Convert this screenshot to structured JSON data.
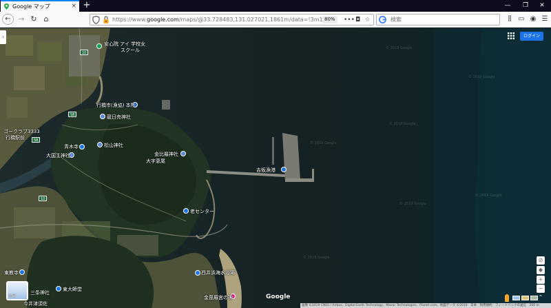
{
  "browser": {
    "tab_title": "Google マップ",
    "tab_close": "×",
    "new_tab": "+",
    "url_prefix": "https://www.",
    "url_domain": "google.com",
    "url_path": "/maps/@33.728483,131.027021,1861m/data=!3m1!1e3",
    "zoom": "80%",
    "search_placeholder": "検索",
    "colors": {
      "tabbar": "#0c0c1c",
      "accent": "#0a84ff"
    }
  },
  "map": {
    "login_label": "ログイン",
    "google_logo": "Google",
    "layer_label": "地図",
    "attribution": "画像 ©2019 CNES / Airbus、Digital Earth Technology、Maxar Technologies、Planet.com、地図データ ©2019　日本　利用規約　フィードバックの送信　200 m",
    "watermark": "© 2019 Google",
    "labels": [
      {
        "id": "school",
        "text": "安心院 アイ 学校女"
      },
      {
        "id": "school2",
        "text": "スクール"
      },
      {
        "id": "city-office",
        "text": "行橋市(漁協) 本所"
      },
      {
        "id": "yashiro",
        "text": "龍日売神社"
      },
      {
        "id": "club",
        "text": "ゴークラブ3333"
      },
      {
        "id": "club2",
        "text": "行橋駅前"
      },
      {
        "id": "matsuyama",
        "text": "松山神社"
      },
      {
        "id": "aoki",
        "text": "青木寺"
      },
      {
        "id": "taikou",
        "text": "大国主神社"
      },
      {
        "id": "kompira",
        "text": "金比羅神社"
      },
      {
        "id": "osa",
        "text": "大字恵尾"
      },
      {
        "id": "port",
        "text": "吉坂漁港"
      },
      {
        "id": "center",
        "text": "老センター"
      },
      {
        "id": "beach",
        "text": "西井浜海水浴場"
      },
      {
        "id": "shrine-bottom",
        "text": "金毘羅宮の神"
      },
      {
        "id": "east-station",
        "text": "東大師堂"
      },
      {
        "id": "kanemachi",
        "text": "今井津須佐"
      },
      {
        "id": "dojo",
        "text": "東教寺"
      },
      {
        "id": "sanjo",
        "text": "三条神社"
      }
    ],
    "road_badges": [
      "10",
      "58",
      "10",
      "58"
    ],
    "controls": {
      "compass": "⊘",
      "zoom_in": "+",
      "zoom_out": "−",
      "expand": "⌃"
    }
  }
}
